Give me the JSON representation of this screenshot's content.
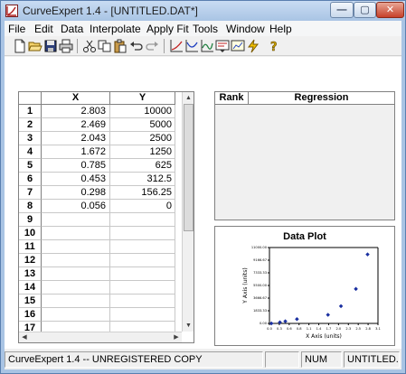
{
  "window": {
    "title": "CurveExpert 1.4 - [UNTITLED.DAT*]",
    "minimize_glyph": "—",
    "maximize_glyph": "▢",
    "close_glyph": "✕"
  },
  "menu": {
    "items": [
      "File",
      "Edit",
      "Data",
      "Interpolate",
      "Apply Fit",
      "Tools",
      "Window",
      "Help"
    ]
  },
  "toolbar": {
    "icons": [
      "new-icon",
      "open-icon",
      "save-icon",
      "print-icon",
      "cut-icon",
      "copy-icon",
      "paste-icon",
      "undo-icon",
      "redo-icon",
      "curve-finder-icon",
      "polynomial-fit-icon",
      "spline-icon",
      "info-icon",
      "chart-icon",
      "lightning-icon",
      "help-icon"
    ]
  },
  "grid": {
    "headers": {
      "row": "",
      "x": "X",
      "y": "Y"
    },
    "rows": [
      {
        "n": "1",
        "x": "2.803",
        "y": "10000"
      },
      {
        "n": "2",
        "x": "2.469",
        "y": "5000"
      },
      {
        "n": "3",
        "x": "2.043",
        "y": "2500"
      },
      {
        "n": "4",
        "x": "1.672",
        "y": "1250"
      },
      {
        "n": "5",
        "x": "0.785",
        "y": "625"
      },
      {
        "n": "6",
        "x": "0.453",
        "y": "312.5"
      },
      {
        "n": "7",
        "x": "0.298",
        "y": "156.25"
      },
      {
        "n": "8",
        "x": "0.056",
        "y": "0"
      },
      {
        "n": "9",
        "x": "",
        "y": ""
      },
      {
        "n": "10",
        "x": "",
        "y": ""
      },
      {
        "n": "11",
        "x": "",
        "y": ""
      },
      {
        "n": "12",
        "x": "",
        "y": ""
      },
      {
        "n": "13",
        "x": "",
        "y": ""
      },
      {
        "n": "14",
        "x": "",
        "y": ""
      },
      {
        "n": "15",
        "x": "",
        "y": ""
      },
      {
        "n": "16",
        "x": "",
        "y": ""
      },
      {
        "n": "17",
        "x": "",
        "y": ""
      }
    ]
  },
  "rank_panel": {
    "rank_header": "Rank",
    "regression_header": "Regression"
  },
  "plot": {
    "title": "Data Plot",
    "xlabel": "X Axis (units)",
    "ylabel": "Y Axis (units)",
    "point_color": "#1a2fa0"
  },
  "chart_data": {
    "type": "scatter",
    "title": "Data Plot",
    "xlabel": "X Axis (units)",
    "ylabel": "Y Axis (units)",
    "x": [
      2.803,
      2.469,
      2.043,
      1.672,
      0.785,
      0.453,
      0.298,
      0.056
    ],
    "y": [
      10000,
      5000,
      2500,
      1250,
      625,
      312.5,
      156.25,
      0
    ],
    "xlim": [
      0.0,
      3.1
    ],
    "ylim": [
      0,
      11000
    ],
    "x_ticks": [
      "0.0",
      "0.3",
      "0.6",
      "0.8",
      "1.1",
      "1.4",
      "1.7",
      "2.0",
      "2.3",
      "2.5",
      "2.8",
      "3.1"
    ],
    "y_ticks": [
      "0.00",
      "1833.33",
      "3666.67",
      "5500.00",
      "7333.33",
      "9166.67",
      "11000.00"
    ],
    "grid": false,
    "legend": "none"
  },
  "status": {
    "message": "CurveExpert 1.4 -- UNREGISTERED COPY",
    "empty": "",
    "num": "NUM",
    "file": "UNTITLED.DAT"
  }
}
